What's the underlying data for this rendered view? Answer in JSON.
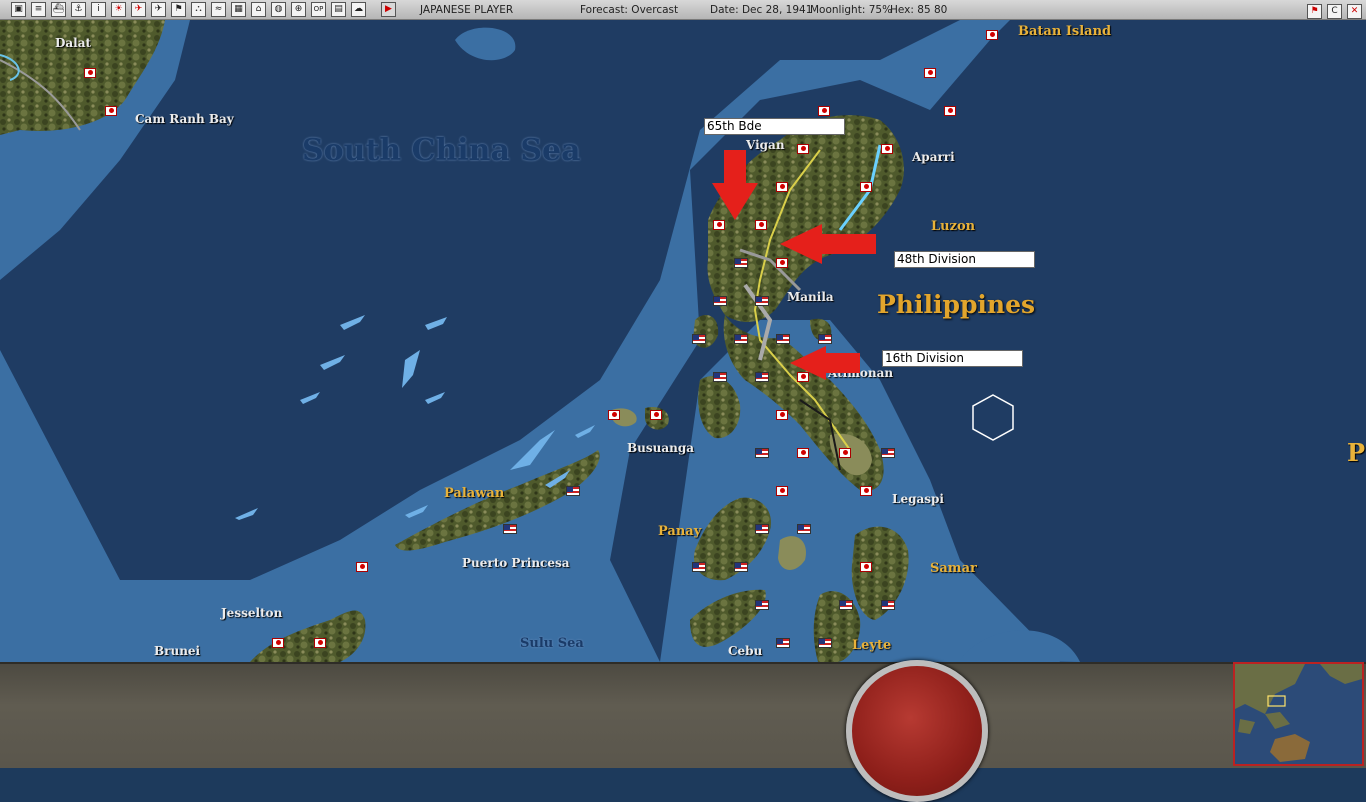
{
  "toolbar": {
    "buttons": [
      {
        "name": "window-icon",
        "glyph": "▣"
      },
      {
        "name": "list-icon",
        "glyph": "≡"
      },
      {
        "name": "ship-icon",
        "glyph": "⛴"
      },
      {
        "name": "taskforce-icon",
        "glyph": "⚓"
      },
      {
        "name": "info-icon",
        "glyph": "i"
      },
      {
        "name": "rising-sun-icon",
        "glyph": "☀"
      },
      {
        "name": "aircraft-icon",
        "glyph": "✈"
      },
      {
        "name": "plane-blue-icon",
        "glyph": "✈"
      },
      {
        "name": "flag-icon",
        "glyph": "⚑"
      },
      {
        "name": "unit-icon",
        "glyph": "⛬"
      },
      {
        "name": "route-icon",
        "glyph": "≈"
      },
      {
        "name": "map-icon",
        "glyph": "▦"
      },
      {
        "name": "base-icon",
        "glyph": "⌂"
      },
      {
        "name": "globe-icon",
        "glyph": "◍"
      },
      {
        "name": "reinforce-icon",
        "glyph": "⊕"
      },
      {
        "name": "op-icon",
        "glyph": "OP"
      },
      {
        "name": "table-icon",
        "glyph": "▤"
      },
      {
        "name": "cloud-icon",
        "glyph": "☁"
      },
      {
        "name": "play-icon",
        "glyph": "▶"
      }
    ],
    "player": "JAPANESE PLAYER",
    "forecast": "Forecast: Overcast",
    "date": "Date: Dec 28, 1941",
    "moonlight": "Moonlight: 75%",
    "hex": "Hex: 85  80",
    "right_buttons": [
      {
        "name": "exit-flag-icon",
        "glyph": "⚑"
      },
      {
        "name": "c-button",
        "glyph": "C"
      },
      {
        "name": "close-icon",
        "glyph": "✕"
      }
    ]
  },
  "map": {
    "seas": {
      "south_china_sea": "South China Sea",
      "sulu_sea": "Sulu Sea"
    },
    "country": "Philippines",
    "places": {
      "dalat": "Dalat",
      "cam_ranh_bay": "Cam Ranh Bay",
      "batan_island": "Batan Island",
      "vigan": "Vigan",
      "aparri": "Aparri",
      "luzon": "Luzon",
      "manila": "Manila",
      "atimonan": "Atimonan",
      "busuanga": "Busuanga",
      "palawan": "Palawan",
      "legaspi": "Legaspi",
      "panay": "Panay",
      "samar": "Samar",
      "puerto_princesa": "Puerto Princesa",
      "jesselton": "Jesselton",
      "brunei": "Brunei",
      "cebu": "Cebu",
      "leyte": "Leyte",
      "edge_label": "P"
    },
    "callouts": {
      "bde65": "65th Bde",
      "div48": "48th Division",
      "div16": "16th Division"
    },
    "arrow_color": "#e5201b",
    "land_color": "#4f5a2c",
    "shallow_water": "#3b6fa3",
    "deep_water": "#1f3c63"
  },
  "bottom": {
    "panel_color": "#57534a",
    "button_color": "#9b2a23"
  }
}
